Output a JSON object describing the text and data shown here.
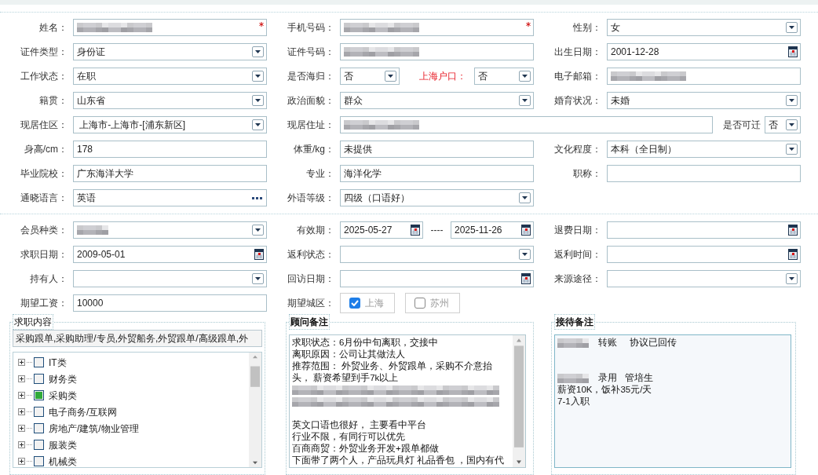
{
  "form": [
    [
      {
        "kind": "standard",
        "label": "姓名：",
        "fields": [
          {
            "kind": "text",
            "blurred": true,
            "required": true
          }
        ]
      },
      {
        "kind": "standard",
        "label": "手机号码：",
        "fields": [
          {
            "kind": "text",
            "blurred": true,
            "required": true
          }
        ]
      },
      {
        "kind": "standard",
        "label": "性别：",
        "fields": [
          {
            "kind": "select",
            "value": "女"
          }
        ]
      }
    ],
    [
      {
        "kind": "standard",
        "label": "证件类型：",
        "fields": [
          {
            "kind": "select",
            "value": "身份证"
          }
        ]
      },
      {
        "kind": "standard",
        "label": "证件号码：",
        "fields": [
          {
            "kind": "text",
            "blurred": true
          }
        ]
      },
      {
        "kind": "standard",
        "label": "出生日期：",
        "fields": [
          {
            "kind": "date",
            "value": "2001-12-28"
          }
        ]
      }
    ],
    [
      {
        "kind": "standard",
        "label": "工作状态：",
        "fields": [
          {
            "kind": "select",
            "value": "在职"
          }
        ]
      },
      {
        "kind": "standard",
        "label": "是否海归：",
        "fields": [
          {
            "kind": "select",
            "value": "否"
          },
          {
            "kind": "label",
            "text": "上海户口：",
            "emphasis": true
          },
          {
            "kind": "select",
            "value": "否"
          }
        ]
      },
      {
        "kind": "standard",
        "label": "电子邮箱：",
        "fields": [
          {
            "kind": "text",
            "blurred": true
          }
        ]
      }
    ],
    [
      {
        "kind": "standard",
        "label": "籍贯：",
        "fields": [
          {
            "kind": "select",
            "value": "山东省"
          }
        ]
      },
      {
        "kind": "standard",
        "label": "政治面貌：",
        "fields": [
          {
            "kind": "select",
            "value": "群众"
          }
        ]
      },
      {
        "kind": "standard",
        "label": "婚育状况：",
        "fields": [
          {
            "kind": "select",
            "value": "未婚"
          }
        ]
      }
    ],
    [
      {
        "kind": "standard",
        "label": "现居住区：",
        "fields": [
          {
            "kind": "select",
            "value": " 上海市-上海市-[浦东新区]"
          }
        ]
      },
      {
        "kind": "wide",
        "label": "现居住址：",
        "fields": [
          {
            "kind": "text",
            "blurred": true
          }
        ]
      },
      {
        "kind": "compact",
        "label": "是否可迁",
        "fields": [
          {
            "kind": "select",
            "value": "否"
          }
        ]
      }
    ],
    [
      {
        "kind": "standard",
        "label": "身高/cm：",
        "fields": [
          {
            "kind": "text",
            "value": "178"
          }
        ]
      },
      {
        "kind": "standard",
        "label": "体重/kg：",
        "fields": [
          {
            "kind": "text",
            "value": "未提供"
          }
        ]
      },
      {
        "kind": "standard",
        "label": "文化程度：",
        "fields": [
          {
            "kind": "select",
            "value": "本科（全日制）"
          }
        ]
      }
    ],
    [
      {
        "kind": "standard",
        "label": "毕业院校：",
        "fields": [
          {
            "kind": "text",
            "value": "广东海洋大学"
          }
        ]
      },
      {
        "kind": "standard",
        "label": "专业：",
        "fields": [
          {
            "kind": "text",
            "value": "海洋化学"
          }
        ]
      },
      {
        "kind": "standard",
        "label": "职称：",
        "fields": [
          {
            "kind": "text"
          }
        ]
      }
    ],
    [
      {
        "kind": "standard",
        "label": "通晓语言：",
        "fields": [
          {
            "kind": "lookup",
            "value": "英语"
          }
        ]
      },
      {
        "kind": "standard",
        "label": "外语等级：",
        "fields": [
          {
            "kind": "select",
            "value": "四级（口语好）"
          }
        ]
      }
    ]
  ],
  "membership": [
    [
      {
        "kind": "standard",
        "label": "会员种类：",
        "fields": [
          {
            "kind": "select",
            "blurred": true
          }
        ]
      },
      {
        "kind": "standard",
        "label": "有效期：",
        "fields": [
          {
            "kind": "date",
            "value": "2025-05-27"
          },
          {
            "kind": "dash",
            "text": "----"
          },
          {
            "kind": "date",
            "value": "2025-11-26"
          }
        ]
      },
      {
        "kind": "standard",
        "label": "退费日期：",
        "fields": [
          {
            "kind": "date"
          }
        ]
      }
    ],
    [
      {
        "kind": "standard",
        "label": "求职日期：",
        "fields": [
          {
            "kind": "date",
            "value": "2009-05-01"
          }
        ]
      },
      {
        "kind": "standard",
        "label": "返利状态：",
        "fields": [
          {
            "kind": "select"
          }
        ]
      },
      {
        "kind": "standard",
        "label": "返利时间：",
        "fields": [
          {
            "kind": "date"
          }
        ]
      }
    ],
    [
      {
        "kind": "standard",
        "label": "持有人：",
        "fields": [
          {
            "kind": "select"
          }
        ]
      },
      {
        "kind": "standard",
        "label": "回访日期：",
        "fields": [
          {
            "kind": "date"
          }
        ]
      },
      {
        "kind": "standard",
        "label": "来源途径：",
        "fields": [
          {
            "kind": "select"
          }
        ]
      }
    ],
    [
      {
        "kind": "standard",
        "label": "期望工资：",
        "fields": [
          {
            "kind": "text",
            "value": "10000"
          }
        ]
      },
      {
        "kind": "standard",
        "label": "期望城区：",
        "fields": [
          {
            "kind": "checkbox",
            "text": "上海",
            "checked": true
          },
          {
            "kind": "checkbox",
            "text": "苏州",
            "checked": false
          }
        ]
      }
    ]
  ],
  "job_content": {
    "title": "求职内容",
    "summary": "采购跟单,采购助理/专员,外贸船务,外贸跟单/高级跟单,外",
    "tree": [
      {
        "label": "IT类",
        "checked": false,
        "expanded": false
      },
      {
        "label": "财务类",
        "checked": false,
        "expanded": false
      },
      {
        "label": "采购类",
        "checked": true,
        "expanded": false
      },
      {
        "label": "电子商务/互联网",
        "checked": false,
        "expanded": false
      },
      {
        "label": "房地产/建筑/物业管理",
        "checked": false,
        "expanded": false
      },
      {
        "label": "服装类",
        "checked": false,
        "expanded": false
      },
      {
        "label": "机械类",
        "checked": false,
        "expanded": false
      }
    ]
  },
  "advisor_notes": {
    "title": "顾问备注",
    "lines": [
      {
        "kind": "text",
        "text": "求职状态：6月份中旬离职，交接中"
      },
      {
        "kind": "text",
        "text": "离职原因：公司让其做法人"
      },
      {
        "kind": "text",
        "text": "推荐范围： 外贸业务、外贸跟单，采购不介意抬"
      },
      {
        "kind": "text",
        "text": "头， 薪资希望到手7k以上"
      },
      {
        "kind": "blurred"
      },
      {
        "kind": "blurred"
      },
      {
        "kind": "blank"
      },
      {
        "kind": "text",
        "text": "英文口语也很好， 主要看中平台"
      },
      {
        "kind": "text",
        "text": "行业不限，有同行可以优先"
      },
      {
        "kind": "text",
        "text": "百商商贸：外贸业务开发+跟单都做"
      },
      {
        "kind": "text",
        "text": "下面带了两个人，产品玩具灯 礼品香包 ，国内有代"
      }
    ]
  },
  "reception_notes": {
    "title": "接待备注",
    "lines": [
      {
        "kind": "mixed",
        "text": "转账     协议已回传"
      },
      {
        "kind": "blank"
      },
      {
        "kind": "blank"
      },
      {
        "kind": "mixed",
        "text": "录用   管培生"
      },
      {
        "kind": "text",
        "text": "薪资10K，饭补35元/天"
      },
      {
        "kind": "text",
        "text": "7-1入职"
      }
    ]
  }
}
